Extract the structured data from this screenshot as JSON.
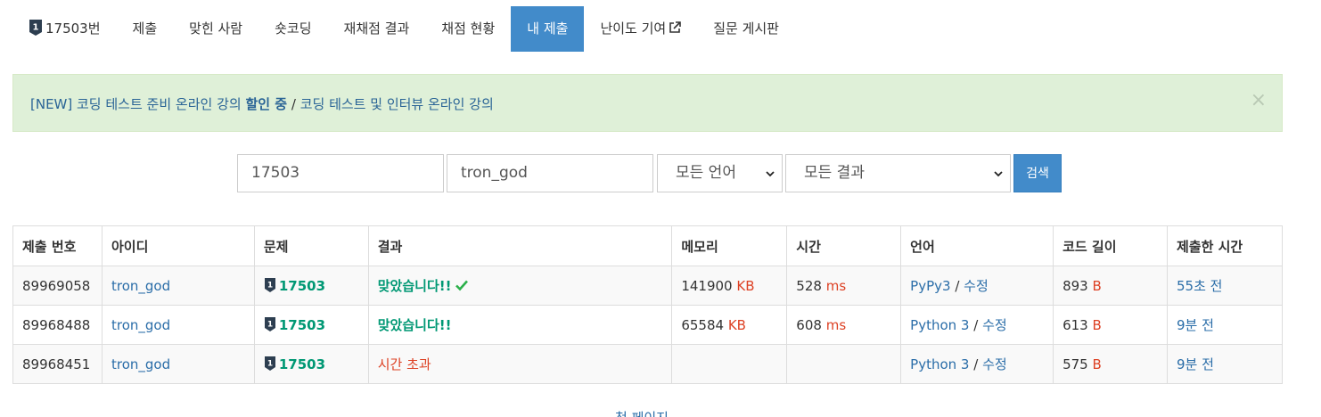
{
  "nav": {
    "items": [
      {
        "label": "17503번"
      },
      {
        "label": "제출"
      },
      {
        "label": "맞힌 사람"
      },
      {
        "label": "숏코딩"
      },
      {
        "label": "재채점 결과"
      },
      {
        "label": "채점 현황"
      },
      {
        "label": "내 제출"
      },
      {
        "label": "난이도 기여"
      },
      {
        "label": "질문 게시판"
      }
    ],
    "active_index": 6
  },
  "alert": {
    "part1": "[NEW] 코딩 테스트 준비 온라인 강의",
    "bold": "할인 중",
    "separator": "/",
    "part2": "코딩 테스트 및 인터뷰 온라인 강의",
    "close": "×"
  },
  "search": {
    "problem_value": "17503",
    "user_value": "tron_god",
    "language_selected": "모든 언어",
    "result_selected": "모든 결과",
    "button_label": "검색"
  },
  "table": {
    "headers": [
      "제출 번호",
      "아이디",
      "문제",
      "결과",
      "메모리",
      "시간",
      "언어",
      "코드 길이",
      "제출한 시간"
    ],
    "rows": [
      {
        "id": "89969058",
        "user": "tron_god",
        "problem": "17503",
        "result": "맞았습니다!!",
        "memory": "141900",
        "memory_unit": "KB",
        "time": "528",
        "time_unit": "ms",
        "lang": "PyPy3",
        "edit": "수정",
        "code_len": "893",
        "code_unit": "B",
        "submitted": "55초 전"
      },
      {
        "id": "89968488",
        "user": "tron_god",
        "problem": "17503",
        "result": "맞았습니다!!",
        "memory": "65584",
        "memory_unit": "KB",
        "time": "608",
        "time_unit": "ms",
        "lang": "Python 3",
        "edit": "수정",
        "code_len": "613",
        "code_unit": "B",
        "submitted": "9분 전"
      },
      {
        "id": "89968451",
        "user": "tron_god",
        "problem": "17503",
        "result": "시간 초과",
        "memory": "",
        "memory_unit": "",
        "time": "",
        "time_unit": "",
        "lang": "Python 3",
        "edit": "수정",
        "code_len": "575",
        "code_unit": "B",
        "submitted": "9분 전"
      }
    ]
  },
  "pagination": {
    "first_page": "첫 페이지"
  },
  "colors": {
    "accent": "#428bca",
    "accepted": "#009874",
    "error": "#dd4124",
    "alert_bg": "#dff0d8"
  }
}
